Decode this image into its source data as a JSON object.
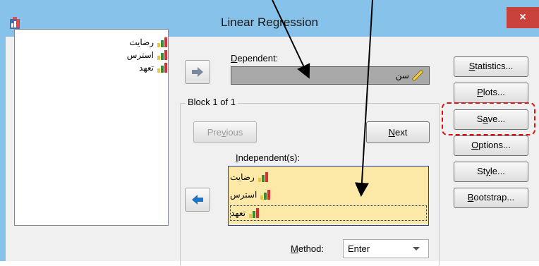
{
  "window": {
    "title": "Linear Regression",
    "close_glyph": "×"
  },
  "variables": [
    {
      "label": "رضایت"
    },
    {
      "label": "استرس"
    },
    {
      "label": "تعهد"
    }
  ],
  "dependent": {
    "label_pre": "",
    "label_ul": "D",
    "label_post": "ependent:",
    "value": "سن"
  },
  "block": {
    "title": "Block 1 of 1",
    "previous_pre": "Pre",
    "previous_ul": "v",
    "previous_post": "ious",
    "next_ul": "N",
    "next_post": "ext"
  },
  "independent": {
    "label_ul": "I",
    "label_post": "ndependent(s):",
    "items": [
      {
        "label": "رضایت"
      },
      {
        "label": "استرس"
      },
      {
        "label": "تعهد"
      }
    ]
  },
  "method": {
    "label_ul": "M",
    "label_post": "ethod:",
    "value": "Enter"
  },
  "side_buttons": [
    {
      "pre": "",
      "ul": "S",
      "post": "tatistics..."
    },
    {
      "pre": "",
      "ul": "P",
      "post": "lots..."
    },
    {
      "pre": "S",
      "ul": "a",
      "post": "ve..."
    },
    {
      "pre": "",
      "ul": "O",
      "post": "ptions..."
    },
    {
      "pre": "St",
      "ul": "y",
      "post": "le..."
    },
    {
      "pre": "",
      "ul": "B",
      "post": "ootstrap..."
    }
  ],
  "colors": {
    "titlebar": "#87c2ea",
    "highlight": "#e01010",
    "list_bg": "#fde9a7",
    "close": "#c9413b"
  }
}
